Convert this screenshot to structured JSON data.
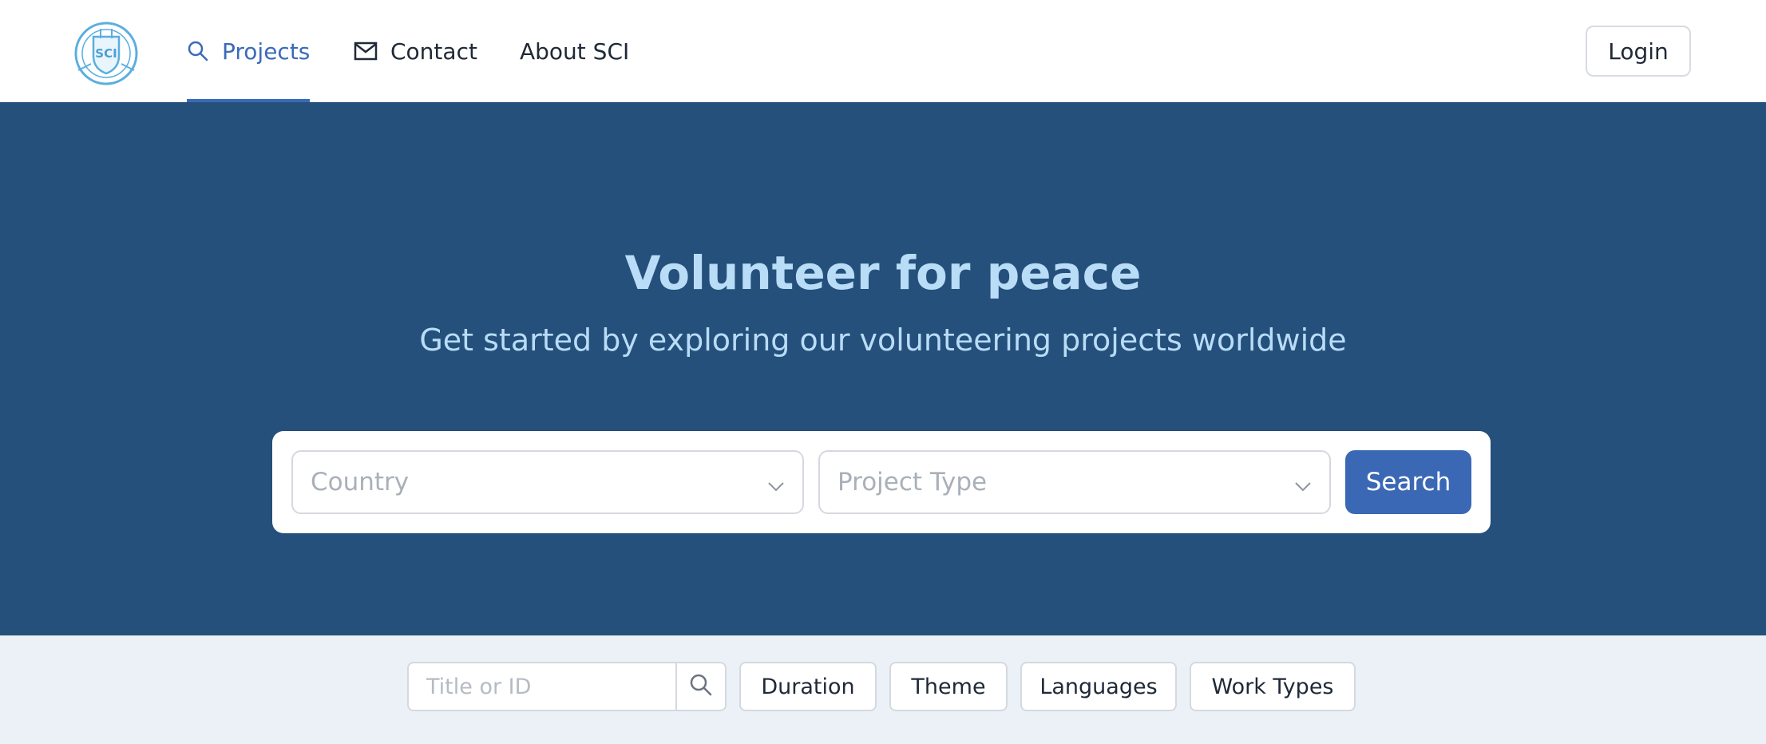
{
  "header": {
    "logo_text": "SCI",
    "nav": [
      {
        "label": "Projects",
        "icon": "search-icon",
        "active": true
      },
      {
        "label": "Contact",
        "icon": "mail-icon",
        "active": false
      },
      {
        "label": "About SCI",
        "active": false
      }
    ],
    "login_label": "Login"
  },
  "hero": {
    "title": "Volunteer for peace",
    "subtitle": "Get started by exploring our volunteering projects worldwide",
    "country_placeholder": "Country",
    "project_type_placeholder": "Project Type",
    "search_label": "Search"
  },
  "filters": {
    "title_placeholder": "Title or ID",
    "chips": [
      "Duration",
      "Theme",
      "Languages",
      "Work Types"
    ]
  },
  "colors": {
    "accent": "#3a6bb8",
    "hero_bg": "#24507b",
    "hero_text": "#b9dcf7",
    "filter_bg": "#ebf1f7"
  }
}
